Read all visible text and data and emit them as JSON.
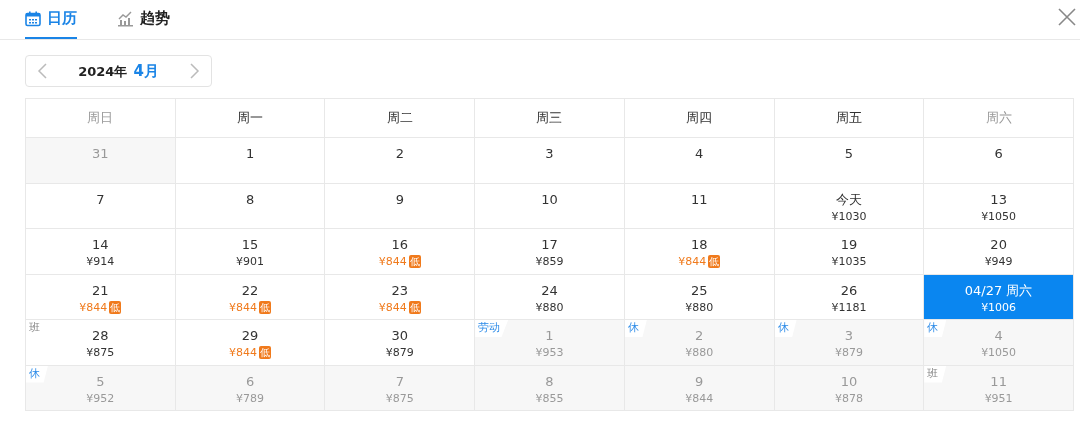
{
  "tabs": [
    {
      "label": "日历",
      "selected": true
    },
    {
      "label": "趋势",
      "selected": false
    }
  ],
  "month_nav": {
    "year": "2024年",
    "month": "4月"
  },
  "weekdays": [
    {
      "label": "周日",
      "weekend": true
    },
    {
      "label": "周一",
      "weekend": false
    },
    {
      "label": "周二",
      "weekend": false
    },
    {
      "label": "周三",
      "weekend": false
    },
    {
      "label": "周四",
      "weekend": false
    },
    {
      "label": "周五",
      "weekend": false
    },
    {
      "label": "周六",
      "weekend": true
    }
  ],
  "weeks": [
    [
      {
        "day": "31",
        "outside": true,
        "selected": false
      },
      {
        "day": "1",
        "outside": false,
        "selected": false
      },
      {
        "day": "2",
        "outside": false,
        "selected": false
      },
      {
        "day": "3",
        "outside": false,
        "selected": false
      },
      {
        "day": "4",
        "outside": false,
        "selected": false
      },
      {
        "day": "5",
        "outside": false,
        "selected": false
      },
      {
        "day": "6",
        "outside": false,
        "selected": false
      }
    ],
    [
      {
        "day": "7",
        "outside": false,
        "selected": false
      },
      {
        "day": "8",
        "outside": false,
        "selected": false
      },
      {
        "day": "9",
        "outside": false,
        "selected": false
      },
      {
        "day": "10",
        "outside": false,
        "selected": false
      },
      {
        "day": "11",
        "outside": false,
        "selected": false
      },
      {
        "day": "今天",
        "price": "¥1030",
        "outside": false,
        "selected": false
      },
      {
        "day": "13",
        "price": "¥1050",
        "outside": false,
        "selected": false
      }
    ],
    [
      {
        "day": "14",
        "price": "¥914",
        "outside": false,
        "selected": false
      },
      {
        "day": "15",
        "price": "¥901",
        "outside": false,
        "selected": false
      },
      {
        "day": "16",
        "price": "¥844",
        "badge": "低",
        "outside": false,
        "selected": false
      },
      {
        "day": "17",
        "price": "¥859",
        "outside": false,
        "selected": false
      },
      {
        "day": "18",
        "price": "¥844",
        "badge": "低",
        "outside": false,
        "selected": false
      },
      {
        "day": "19",
        "price": "¥1035",
        "outside": false,
        "selected": false
      },
      {
        "day": "20",
        "price": "¥949",
        "outside": false,
        "selected": false
      }
    ],
    [
      {
        "day": "21",
        "price": "¥844",
        "badge": "低",
        "outside": false,
        "selected": false
      },
      {
        "day": "22",
        "price": "¥844",
        "badge": "低",
        "outside": false,
        "selected": false
      },
      {
        "day": "23",
        "price": "¥844",
        "badge": "低",
        "outside": false,
        "selected": false
      },
      {
        "day": "24",
        "price": "¥880",
        "outside": false,
        "selected": false
      },
      {
        "day": "25",
        "price": "¥880",
        "outside": false,
        "selected": false
      },
      {
        "day": "26",
        "price": "¥1181",
        "outside": false,
        "selected": false
      },
      {
        "day": "04/27 周六",
        "price": "¥1006",
        "outside": false,
        "selected": true
      }
    ],
    [
      {
        "day": "28",
        "price": "¥875",
        "tag": {
          "text": "班",
          "kind": "work"
        },
        "outside": false,
        "selected": false
      },
      {
        "day": "29",
        "price": "¥844",
        "badge": "低",
        "outside": false,
        "selected": false
      },
      {
        "day": "30",
        "price": "¥879",
        "outside": false,
        "selected": false
      },
      {
        "day": "1",
        "price": "¥953",
        "tag": {
          "text": "劳动",
          "kind": "holiday"
        },
        "outside": true,
        "selected": false
      },
      {
        "day": "2",
        "price": "¥880",
        "tag": {
          "text": "休",
          "kind": "holiday"
        },
        "outside": true,
        "selected": false
      },
      {
        "day": "3",
        "price": "¥879",
        "tag": {
          "text": "休",
          "kind": "holiday"
        },
        "outside": true,
        "selected": false
      },
      {
        "day": "4",
        "price": "¥1050",
        "tag": {
          "text": "休",
          "kind": "holiday"
        },
        "outside": true,
        "selected": false
      }
    ],
    [
      {
        "day": "5",
        "price": "¥952",
        "tag": {
          "text": "休",
          "kind": "holiday"
        },
        "outside": true,
        "selected": false
      },
      {
        "day": "6",
        "price": "¥789",
        "outside": true,
        "selected": false
      },
      {
        "day": "7",
        "price": "¥875",
        "outside": true,
        "selected": false
      },
      {
        "day": "8",
        "price": "¥855",
        "outside": true,
        "selected": false
      },
      {
        "day": "9",
        "price": "¥844",
        "outside": true,
        "selected": false
      },
      {
        "day": "10",
        "price": "¥878",
        "outside": true,
        "selected": false
      },
      {
        "day": "11",
        "price": "¥951",
        "tag": {
          "text": "班",
          "kind": "work"
        },
        "outside": true,
        "selected": false
      }
    ]
  ]
}
